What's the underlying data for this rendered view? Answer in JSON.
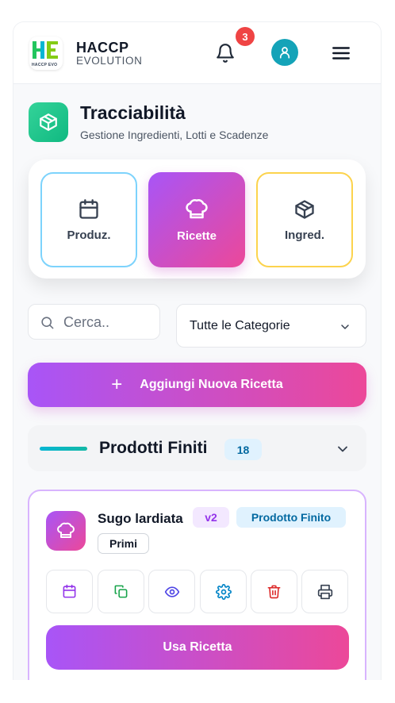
{
  "header": {
    "logo_mini": "HACCP EVO",
    "brand_line1": "HACCP",
    "brand_line2": "EVOLUTION",
    "notification_count": "3"
  },
  "page": {
    "title": "Tracciabilità",
    "subtitle": "Gestione Ingredienti, Lotti e Scadenze"
  },
  "tabs": [
    {
      "label": "Produz.",
      "icon": "calendar-icon",
      "active": false
    },
    {
      "label": "Ricette",
      "icon": "chef-hat-icon",
      "active": true
    },
    {
      "label": "Ingred.",
      "icon": "box-icon",
      "active": false
    }
  ],
  "search": {
    "placeholder": "Cerca.."
  },
  "category_select": {
    "selected": "Tutte le Categorie"
  },
  "add_button": {
    "label": "Aggiungi Nuova Ricetta"
  },
  "group": {
    "title": "Prodotti Finiti",
    "count": "18"
  },
  "recipe": {
    "name": "Sugo lardiata",
    "version": "v2",
    "type": "Prodotto Finito",
    "tag": "Primi",
    "actions": [
      "calendar-icon",
      "copy-icon",
      "eye-icon",
      "gear-icon",
      "trash-icon",
      "printer-icon"
    ],
    "use_label": "Usa Ricetta"
  },
  "colors": {
    "accent_gradient_start": "#a855f7",
    "accent_gradient_end": "#ec4899",
    "badge_red": "#ef4444",
    "avatar_teal": "#14a3b8",
    "title_icon_green": "#10b981"
  }
}
